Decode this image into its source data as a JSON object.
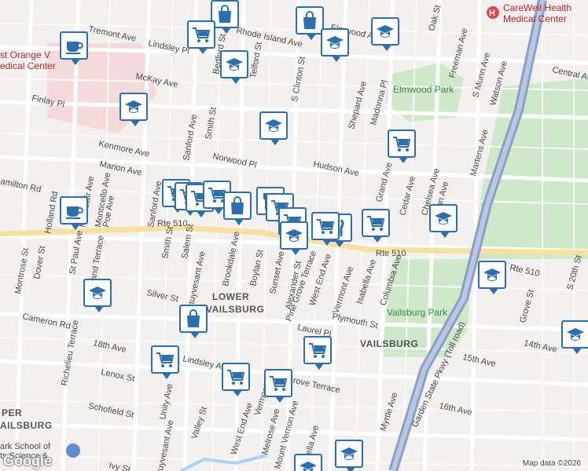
{
  "map": {
    "attribution": "Map data ©2026",
    "logo": "Google",
    "areas": [
      "LOWER",
      "VAILSBURG",
      "VAILSBURG",
      "PER",
      "AILSBURG"
    ],
    "parks": [
      "Elmwood Park",
      "Vailsburg Park"
    ],
    "pois": [
      "CareWell Health",
      "Medical Center",
      "st Orange V",
      "edical Center",
      "ark School of",
      "ts Science &"
    ],
    "streets": [
      "Tremont Ave",
      "Rhode Island Ave",
      "Lindsley Pl",
      "McKay Ave",
      "Finlay Pl",
      "Central Ave",
      "Kenmore Ave",
      "Norwood Pl",
      "Marion Ave",
      "Hudson Ave",
      "Rte 510",
      "Rte 510",
      "Rte 510",
      "Sanford Ave",
      "Sanford Ave",
      "Smith St",
      "Salem St",
      "Stuyvesant Ave",
      "Brookdale Ave",
      "Boylan St",
      "Sunset Ave",
      "Alexander St",
      "Pine Grove Terrace",
      "West End Ave",
      "Vermont Ave",
      "Isabella Ave",
      "Columbia Ave",
      "Plymouth St",
      "Laurel Pl",
      "Silver St",
      "Cameron Rd",
      "18th Ave",
      "Lenox St",
      "Schofield St",
      "Unity Ave",
      "Valley St",
      "Lindsley Ave",
      "Grove Terrace",
      "16th Ave",
      "15th Ave",
      "14th Ave",
      "Myrtle Ave",
      "Garden State Pkwy (Toll road)",
      "Grove St",
      "S 20th St",
      "Watson Ave",
      "S Munn Ave",
      "N Munn Ave",
      "Martens Ave",
      "Chelsea Ave",
      "Cedar Ave",
      "Grand Ave",
      "Shepard Ave",
      "Madonna Pl",
      "Freeman Ave",
      "Oak St",
      "S Clinton St",
      "Telford St",
      "Bedford St",
      "Smith St",
      "Holland Rd",
      "Montclair Ave",
      "Monticello Ave",
      "Poe Ave",
      "Dover St",
      "St Paul Ave",
      "Oakland Terrace",
      "Montrose St",
      "Richelieu Terrace",
      "Elmwood Ave",
      "Mount Vernon Ave",
      "Melrose Ave",
      "Isabella Ave",
      "Ivy St",
      "amilton Rd",
      "Stuyvesant Ave",
      "West End Ave",
      "Vermont Ave"
    ],
    "markers": [
      {
        "type": "shopping-bag"
      },
      {
        "type": "shopping-bag"
      },
      {
        "type": "grocery-cart"
      },
      {
        "type": "school"
      },
      {
        "type": "school"
      },
      {
        "type": "school"
      },
      {
        "type": "cafe"
      },
      {
        "type": "cafe"
      },
      {
        "type": "school"
      },
      {
        "type": "school"
      },
      {
        "type": "grocery-cart"
      },
      {
        "type": "grocery-cart"
      },
      {
        "type": "grocery-cart"
      },
      {
        "type": "grocery-cart"
      },
      {
        "type": "grocery-cart"
      },
      {
        "type": "shopping-bag"
      },
      {
        "type": "restaurant"
      },
      {
        "type": "grocery-cart"
      },
      {
        "type": "grocery-cart"
      },
      {
        "type": "school"
      },
      {
        "type": "restaurant"
      },
      {
        "type": "grocery-cart"
      },
      {
        "type": "school"
      },
      {
        "type": "school"
      },
      {
        "type": "school"
      },
      {
        "type": "school"
      },
      {
        "type": "shopping-bag"
      },
      {
        "type": "grocery-cart"
      },
      {
        "type": "grocery-cart"
      },
      {
        "type": "grocery-cart"
      },
      {
        "type": "grocery-cart"
      },
      {
        "type": "school"
      },
      {
        "type": "school"
      },
      {
        "type": "grocery-cart"
      }
    ]
  }
}
